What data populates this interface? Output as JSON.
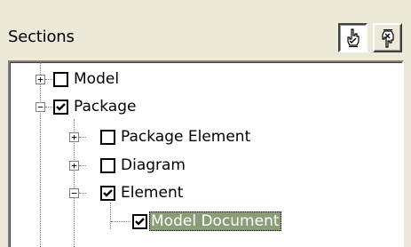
{
  "header": {
    "title": "Sections"
  },
  "toolbar": {
    "check_all_icon": "hand-check-all-icon",
    "uncheck_all_icon": "hand-uncheck-all-icon"
  },
  "tree": {
    "nodes": [
      {
        "label": "Model",
        "expander": "+",
        "checked": false
      },
      {
        "label": "Package",
        "expander": "−",
        "checked": true
      },
      {
        "label": "Package Element",
        "expander": "+",
        "checked": false
      },
      {
        "label": "Diagram",
        "expander": "+",
        "checked": false
      },
      {
        "label": "Element",
        "expander": "−",
        "checked": true
      },
      {
        "label": "Model Document",
        "expander": "",
        "checked": true,
        "selected": true
      }
    ]
  }
}
